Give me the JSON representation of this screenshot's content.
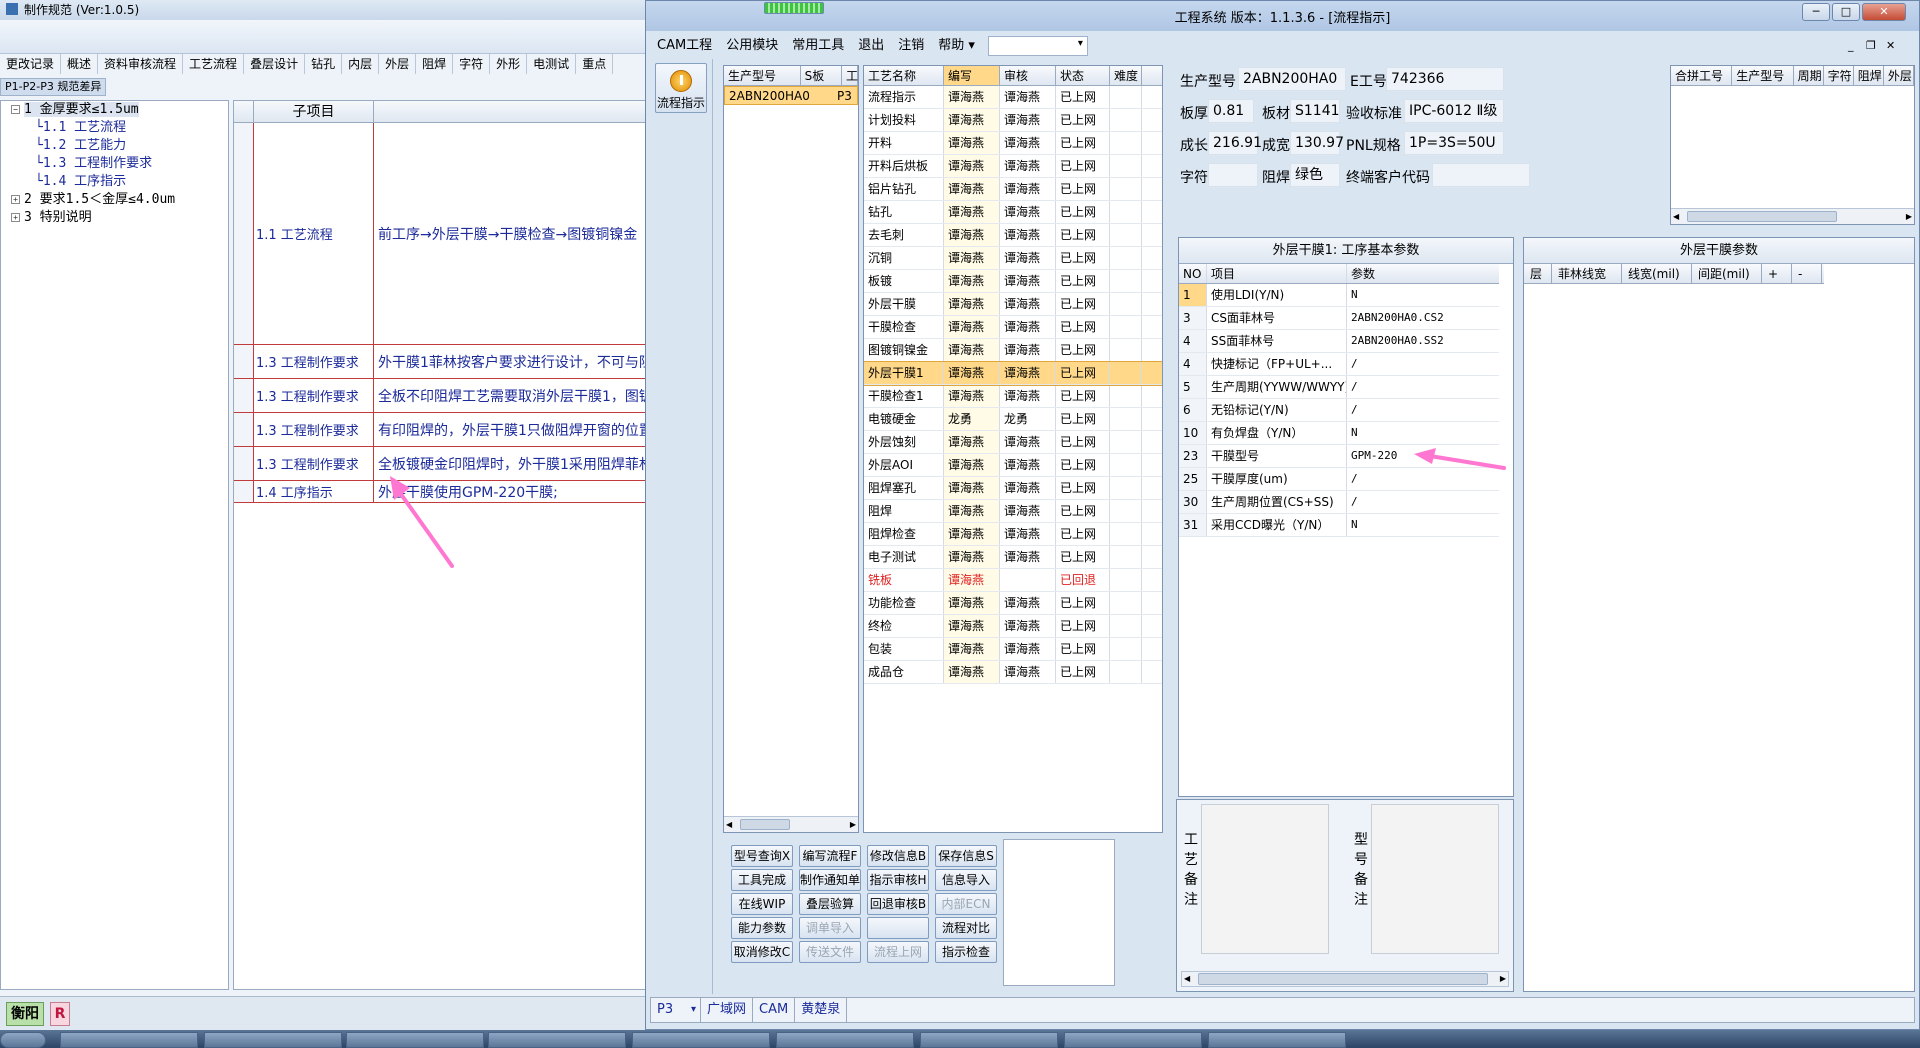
{
  "back_window": {
    "title": "制作规范 (Ver:1.0.5)",
    "tabs": [
      "更改记录",
      "概述",
      "资料审核流程",
      "工艺流程",
      "叠层设计",
      "钻孔",
      "内层",
      "外层",
      "阻焊",
      "字符",
      "外形",
      "电测试",
      "重点"
    ],
    "subtab": "P1-P2-P3 规范差异",
    "tree": [
      {
        "label": "1 金厚要求≤1.5um",
        "expander": "−",
        "level": 0
      },
      {
        "label": "1.1 工艺流程",
        "level": 1
      },
      {
        "label": "1.2 工艺能力",
        "level": 1
      },
      {
        "label": "1.3 工程制作要求",
        "level": 1
      },
      {
        "label": "1.4 工序指示",
        "level": 1
      },
      {
        "label": "2 要求1.5＜金厚≤4.0um",
        "expander": "+",
        "level": 0
      },
      {
        "label": "3 特别说明",
        "expander": "+",
        "level": 0
      }
    ],
    "detail_header": "子项目",
    "detail_rows": [
      {
        "item": "1.1 工艺流程",
        "content": "前工序→外层干膜→干膜检查→图镀铜镍金"
      },
      {
        "item": "1.3 工程制作要求",
        "content": "外干膜1菲林按客户要求进行设计，不可与阻"
      },
      {
        "item": "1.3 工程制作要求",
        "content": "全板不印阻焊工艺需要取消外层干膜1，图镀"
      },
      {
        "item": "1.3 工程制作要求",
        "content": "有印阻焊的，外层干膜1只做阻焊开窗的位置"
      },
      {
        "item": "1.3 工程制作要求",
        "content": "全板镀硬金印阻焊时，外干膜1采用阻焊菲林"
      },
      {
        "item": "1.4 工序指示",
        "content": "外层干膜使用GPM-220干膜;"
      }
    ],
    "status_city": "衡阳",
    "status_r": "R"
  },
  "main_window": {
    "title": "工程系统  版本：1.1.3.6 - [流程指示]",
    "win_buttons": {
      "minimize": "─",
      "maximize": "□",
      "close": "✕"
    },
    "mdi_controls": [
      "_",
      "❐",
      "✕"
    ],
    "menu": [
      "CAM工程",
      "公用模块",
      "常用工具",
      "退出",
      "注销",
      "帮助 ▾"
    ],
    "flow_button": "流程指示",
    "product_list": {
      "columns": [
        "生产型号",
        "S板",
        "工"
      ],
      "rows": [
        {
          "model": "2ABN200HA0",
          "s": "P3",
          "g": ""
        }
      ]
    },
    "process_table": {
      "columns": [
        "工艺名称",
        "编写",
        "审核",
        "状态",
        "难度"
      ],
      "rows": [
        {
          "name": "流程指示",
          "writer": "谭海燕",
          "reviewer": "谭海燕",
          "status": "已上网"
        },
        {
          "name": "计划投料",
          "writer": "谭海燕",
          "reviewer": "谭海燕",
          "status": "已上网"
        },
        {
          "name": "开料",
          "writer": "谭海燕",
          "reviewer": "谭海燕",
          "status": "已上网"
        },
        {
          "name": "开料后烘板",
          "writer": "谭海燕",
          "reviewer": "谭海燕",
          "status": "已上网"
        },
        {
          "name": "铝片钻孔",
          "writer": "谭海燕",
          "reviewer": "谭海燕",
          "status": "已上网"
        },
        {
          "name": "钻孔",
          "writer": "谭海燕",
          "reviewer": "谭海燕",
          "status": "已上网"
        },
        {
          "name": "去毛刺",
          "writer": "谭海燕",
          "reviewer": "谭海燕",
          "status": "已上网"
        },
        {
          "name": "沉铜",
          "writer": "谭海燕",
          "reviewer": "谭海燕",
          "status": "已上网"
        },
        {
          "name": "板镀",
          "writer": "谭海燕",
          "reviewer": "谭海燕",
          "status": "已上网"
        },
        {
          "name": "外层干膜",
          "writer": "谭海燕",
          "reviewer": "谭海燕",
          "status": "已上网"
        },
        {
          "name": "干膜检查",
          "writer": "谭海燕",
          "reviewer": "谭海燕",
          "status": "已上网"
        },
        {
          "name": "图镀铜镍金",
          "writer": "谭海燕",
          "reviewer": "谭海燕",
          "status": "已上网"
        },
        {
          "name": "外层干膜1",
          "writer": "谭海燕",
          "reviewer": "谭海燕",
          "status": "已上网",
          "selected": true
        },
        {
          "name": "干膜检查1",
          "writer": "谭海燕",
          "reviewer": "谭海燕",
          "status": "已上网"
        },
        {
          "name": "电镀硬金",
          "writer": "龙勇",
          "reviewer": "龙勇",
          "status": "已上网"
        },
        {
          "name": "外层蚀刻",
          "writer": "谭海燕",
          "reviewer": "谭海燕",
          "status": "已上网"
        },
        {
          "name": "外层AOI",
          "writer": "谭海燕",
          "reviewer": "谭海燕",
          "status": "已上网"
        },
        {
          "name": "阻焊塞孔",
          "writer": "谭海燕",
          "reviewer": "谭海燕",
          "status": "已上网"
        },
        {
          "name": "阻焊",
          "writer": "谭海燕",
          "reviewer": "谭海燕",
          "status": "已上网"
        },
        {
          "name": "阻焊检查",
          "writer": "谭海燕",
          "reviewer": "谭海燕",
          "status": "已上网"
        },
        {
          "name": "电子测试",
          "writer": "谭海燕",
          "reviewer": "谭海燕",
          "status": "已上网"
        },
        {
          "name": "铣板",
          "writer": "谭海燕",
          "reviewer": "",
          "status": "已回退",
          "red": true
        },
        {
          "name": "功能检查",
          "writer": "谭海燕",
          "reviewer": "谭海燕",
          "status": "已上网"
        },
        {
          "name": "终检",
          "writer": "谭海燕",
          "reviewer": "谭海燕",
          "status": "已上网"
        },
        {
          "name": "包装",
          "writer": "谭海燕",
          "reviewer": "谭海燕",
          "status": "已上网"
        },
        {
          "name": "成品仓",
          "writer": "谭海燕",
          "reviewer": "谭海燕",
          "status": "已上网"
        }
      ]
    },
    "buttons": [
      {
        "label": "型号查询Ⅹ",
        "enabled": true
      },
      {
        "label": "编写流程F",
        "enabled": true
      },
      {
        "label": "修改信息B",
        "enabled": true
      },
      {
        "label": "保存信息S",
        "enabled": true
      },
      {
        "label": "工具完成",
        "enabled": true
      },
      {
        "label": "制作通知单",
        "enabled": true
      },
      {
        "label": "指示审核H",
        "enabled": true
      },
      {
        "label": "信息导入",
        "enabled": true
      },
      {
        "label": "在线WIP",
        "enabled": true
      },
      {
        "label": "叠层验算",
        "enabled": true
      },
      {
        "label": "回退审核B",
        "enabled": true
      },
      {
        "label": "内部ECN",
        "enabled": false
      },
      {
        "label": "能力参数",
        "enabled": true
      },
      {
        "label": "调单导入",
        "enabled": false
      },
      {
        "label": "",
        "enabled": true
      },
      {
        "label": "流程对比",
        "enabled": true
      },
      {
        "label": "取消修改C",
        "enabled": true
      },
      {
        "label": "传送文件",
        "enabled": false
      },
      {
        "label": "流程上网",
        "enabled": false
      },
      {
        "label": "指示检查",
        "enabled": true
      }
    ],
    "info": {
      "model_label": "生产型号",
      "model": "2ABN200HA0",
      "e_label": "E工号",
      "e": "742366",
      "thick_label": "板厚",
      "thick": "0.81",
      "mat_label": "板材",
      "mat": "S1141",
      "std_label": "验收标准",
      "std": "IPC-6012 Ⅱ级",
      "len_label": "成长",
      "len": "216.91",
      "wid_label": "成宽",
      "wid": "130.97",
      "pnl_label": "PNL规格",
      "pnl": "1P=3S=50U",
      "char_label": "字符",
      "char": "",
      "mask_label": "阻焊",
      "mask": "绿色",
      "cust_label": "终端客户代码",
      "cust": ""
    },
    "combine_columns": [
      "合拼工号",
      "生产型号",
      "周期",
      "字符",
      "阻焊",
      "外层"
    ],
    "param_panel": {
      "title": "外层干膜1: 工序基本参数",
      "columns": [
        "NO",
        "项目",
        "参数"
      ],
      "rows": [
        {
          "no": "1",
          "item": "使用LDI(Y/N)",
          "value": "N"
        },
        {
          "no": "3",
          "item": "CS面菲林号",
          "value": "2ABN200HA0.CS2"
        },
        {
          "no": "4",
          "item": "SS面菲林号",
          "value": "2ABN200HA0.SS2"
        },
        {
          "no": "4",
          "item": "快捷标记（FP+UL+...",
          "value": "/"
        },
        {
          "no": "5",
          "item": "生产周期(YYWW/WWYY)",
          "value": "/"
        },
        {
          "no": "6",
          "item": "无铅标记(Y/N)",
          "value": "/"
        },
        {
          "no": "10",
          "item": "有负焊盘（Y/N）",
          "value": "N"
        },
        {
          "no": "23",
          "item": "干膜型号",
          "value": "GPM-220"
        },
        {
          "no": "25",
          "item": "干膜厚度(um)",
          "value": "/"
        },
        {
          "no": "30",
          "item": "生产周期位置(CS+SS)",
          "value": "/"
        },
        {
          "no": "31",
          "item": "采用CCD曝光（Y/N）",
          "value": "N"
        }
      ]
    },
    "layer_panel": {
      "title": "外层干膜参数",
      "columns": [
        "层",
        "菲林线宽",
        "线宽(mil)",
        "间距(mil)",
        "+",
        "-"
      ]
    },
    "remarks": {
      "process_label": "工艺备注",
      "model_label": "型号备注"
    },
    "status_bar": [
      "P3",
      "广域网",
      "CAM",
      "黄楚泉"
    ]
  },
  "colors": {
    "selected_row": "#ffd88a",
    "link_blue": "#1c2b9a",
    "annotation_arrow": "#ff66cc",
    "rollback_red": "#e02020"
  }
}
